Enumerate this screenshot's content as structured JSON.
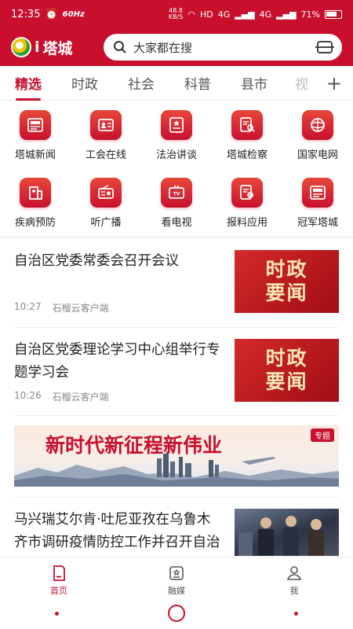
{
  "status": {
    "time": "12:35",
    "refresh": "60Hz",
    "speed_value": "48.8",
    "speed_unit": "KB/S",
    "network": "HD",
    "signal1": "4G",
    "signal2": "4G",
    "battery": "71%"
  },
  "header": {
    "logo_letter": "i",
    "logo_text": "塔城",
    "search_placeholder": "大家都在搜"
  },
  "tabs": [
    {
      "label": "精选"
    },
    {
      "label": "时政"
    },
    {
      "label": "社会"
    },
    {
      "label": "科普"
    },
    {
      "label": "县市"
    },
    {
      "label": "视"
    }
  ],
  "grid": [
    {
      "label": "塔城新闻",
      "icon": "newspaper-icon"
    },
    {
      "label": "工会在线",
      "icon": "id-card-icon"
    },
    {
      "label": "法治讲谈",
      "icon": "certificate-icon"
    },
    {
      "label": "塔城检察",
      "icon": "document-search-icon"
    },
    {
      "label": "国家电网",
      "icon": "grid-globe-icon"
    },
    {
      "label": "疾病预防",
      "icon": "hospital-icon"
    },
    {
      "label": "听广播",
      "icon": "radio-icon"
    },
    {
      "label": "看电视",
      "icon": "tv-icon"
    },
    {
      "label": "报料应用",
      "icon": "report-icon"
    },
    {
      "label": "冠军塔城",
      "icon": "trophy-icon"
    }
  ],
  "news": [
    {
      "title": "自治区党委常委会召开会议",
      "time": "10:27",
      "source": "石榴云客户端",
      "thumb_line1": "时政",
      "thumb_line2": "要闻"
    },
    {
      "title": "自治区党委理论学习中心组举行专题学习会",
      "time": "10:26",
      "source": "石榴云客户端",
      "thumb_line1": "时政",
      "thumb_line2": "要闻"
    },
    {
      "title": "马兴瑞艾尔肯·吐尼亚孜在乌鲁木齐市调研疫情防控工作并召开自治区新冠肺炎疫"
    }
  ],
  "banner": {
    "text": "新时代新征程新伟业",
    "tag": "专题"
  },
  "bottom_nav": [
    {
      "label": "首页",
      "icon": "home-icon"
    },
    {
      "label": "融媒",
      "icon": "media-icon"
    },
    {
      "label": "我",
      "icon": "user-icon"
    }
  ],
  "colors": {
    "brand": "#c8102e"
  }
}
